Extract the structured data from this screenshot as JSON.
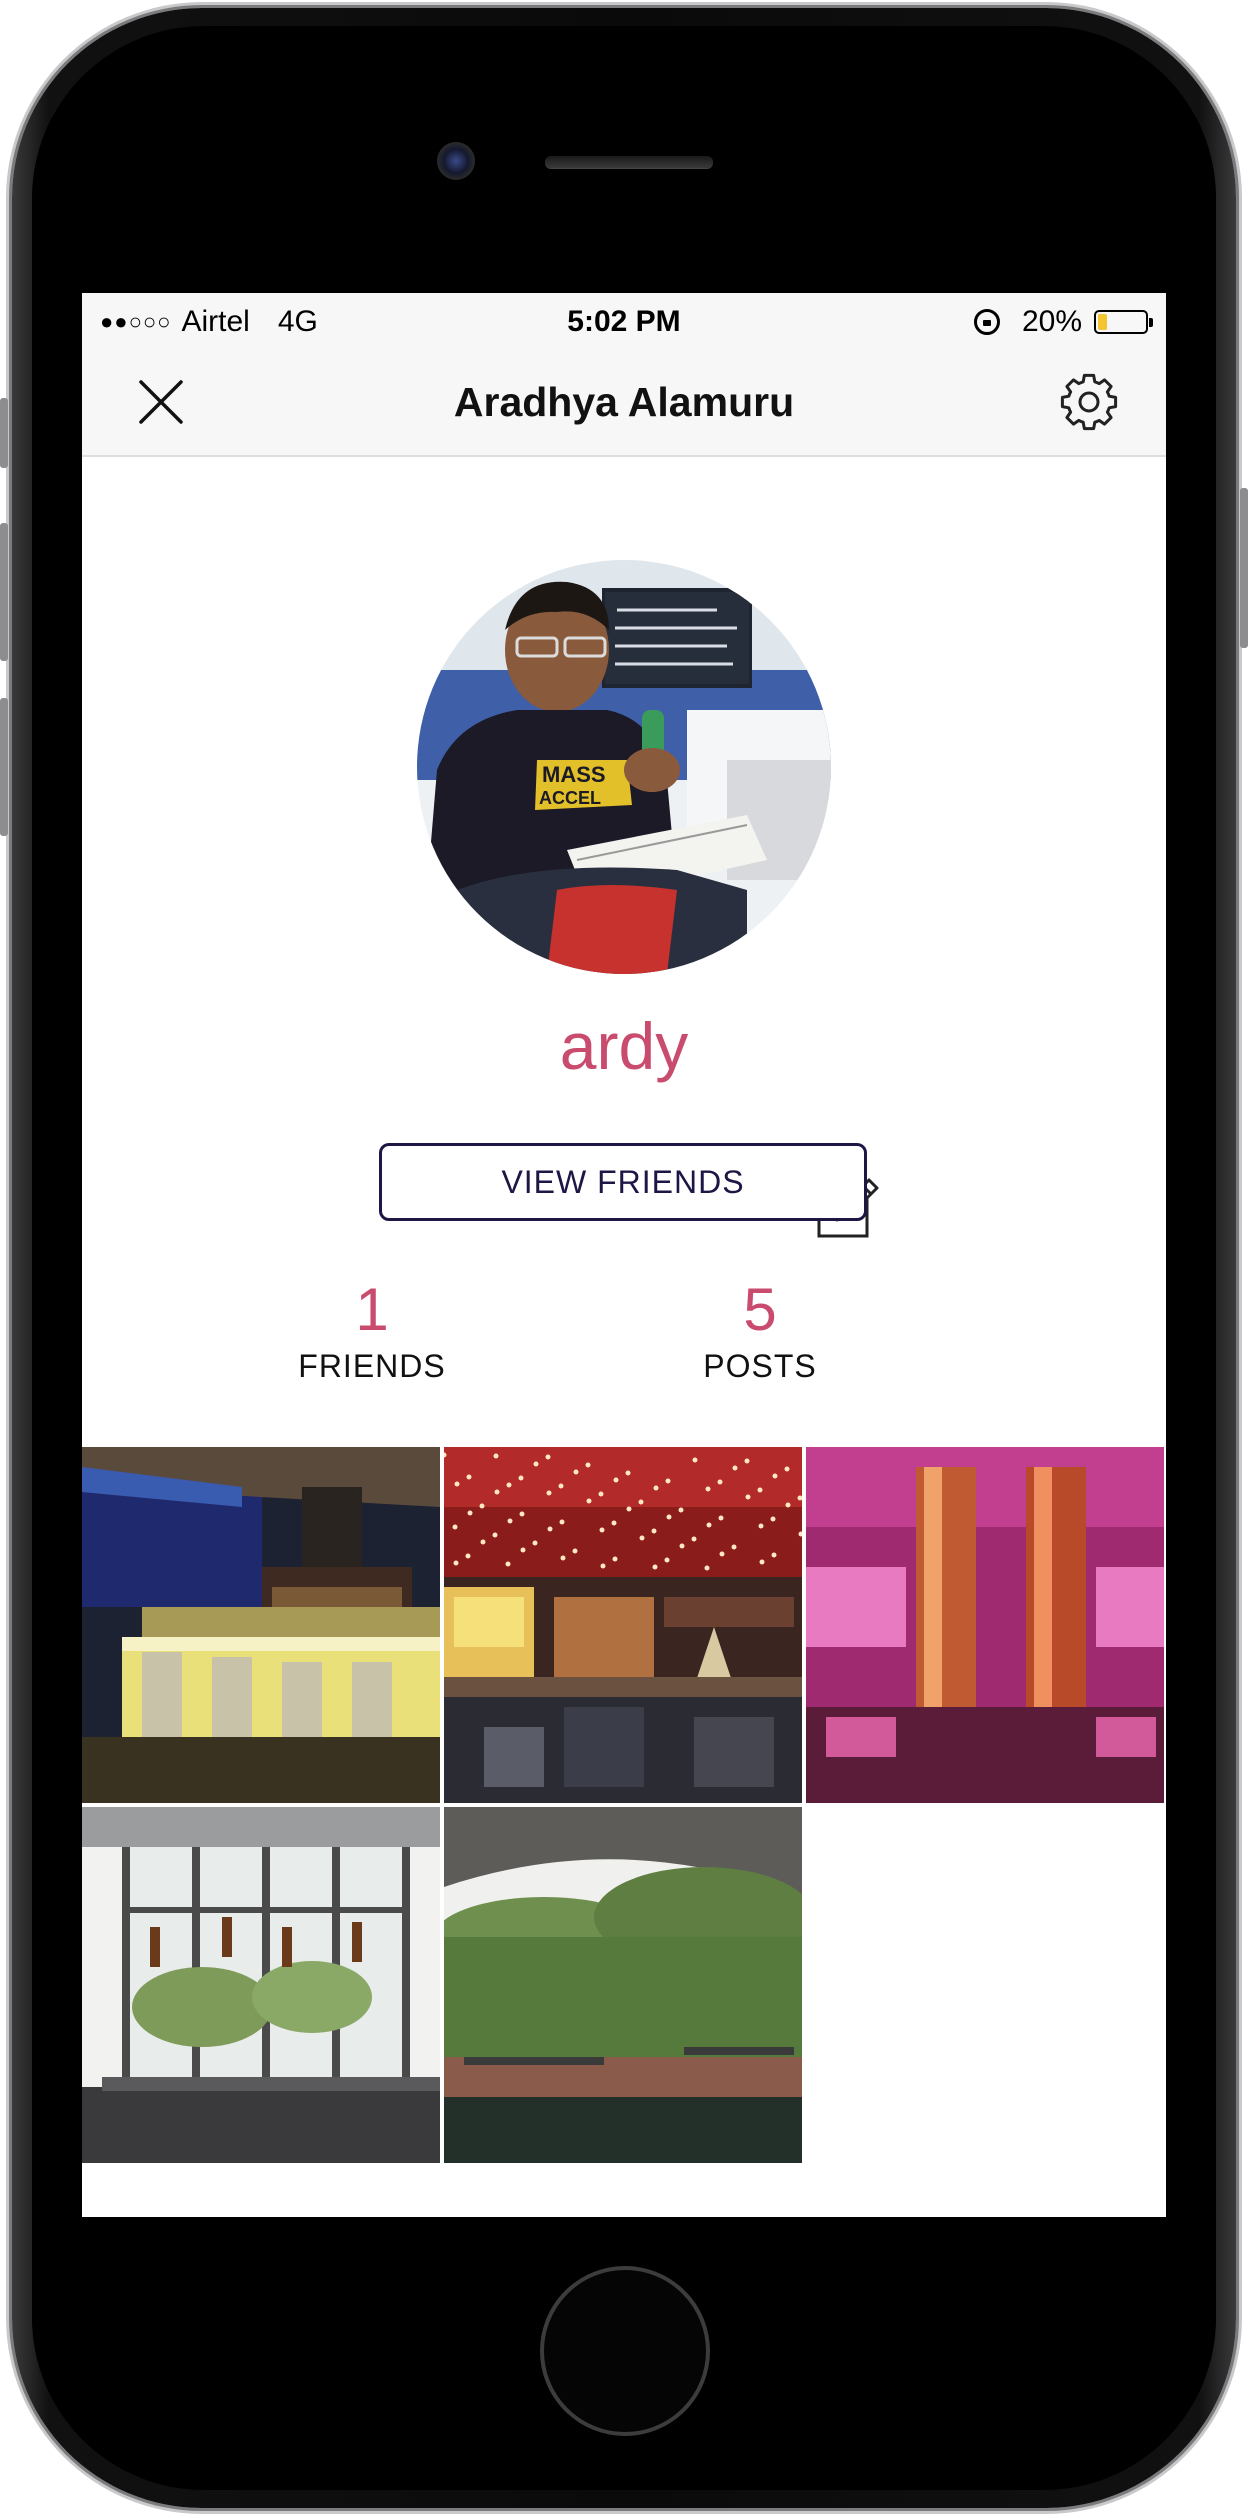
{
  "status_bar": {
    "signal_dots": "●●○○○",
    "carrier": "Airtel",
    "network": "4G",
    "time": "5:02 PM",
    "battery_percent": "20%",
    "battery_level": 0.2
  },
  "nav": {
    "title": "Aradhya Alamuru",
    "left_icon": "close-icon",
    "right_icon": "gear-icon"
  },
  "profile": {
    "username": "ardy",
    "edit_icon": "edit-icon",
    "view_friends_label": "VIEW FRIENDS"
  },
  "stats": {
    "friends_count": "1",
    "friends_label": "FRIENDS",
    "posts_count": "5",
    "posts_label": "POSTS"
  },
  "posts": [
    {
      "id": "post-1",
      "scene": "rooftop bar at night"
    },
    {
      "id": "post-2",
      "scene": "restaurant with red lit ceiling"
    },
    {
      "id": "post-3",
      "scene": "pink neon lounge"
    },
    {
      "id": "post-4",
      "scene": "windows with hanging bottle planters"
    },
    {
      "id": "post-5",
      "scene": "terrace with hedge wall"
    }
  ],
  "colors": {
    "accent": "#c94b6e",
    "button_border": "#1c1745",
    "nav_background": "#f7f7f7",
    "battery": "#f5c431"
  }
}
